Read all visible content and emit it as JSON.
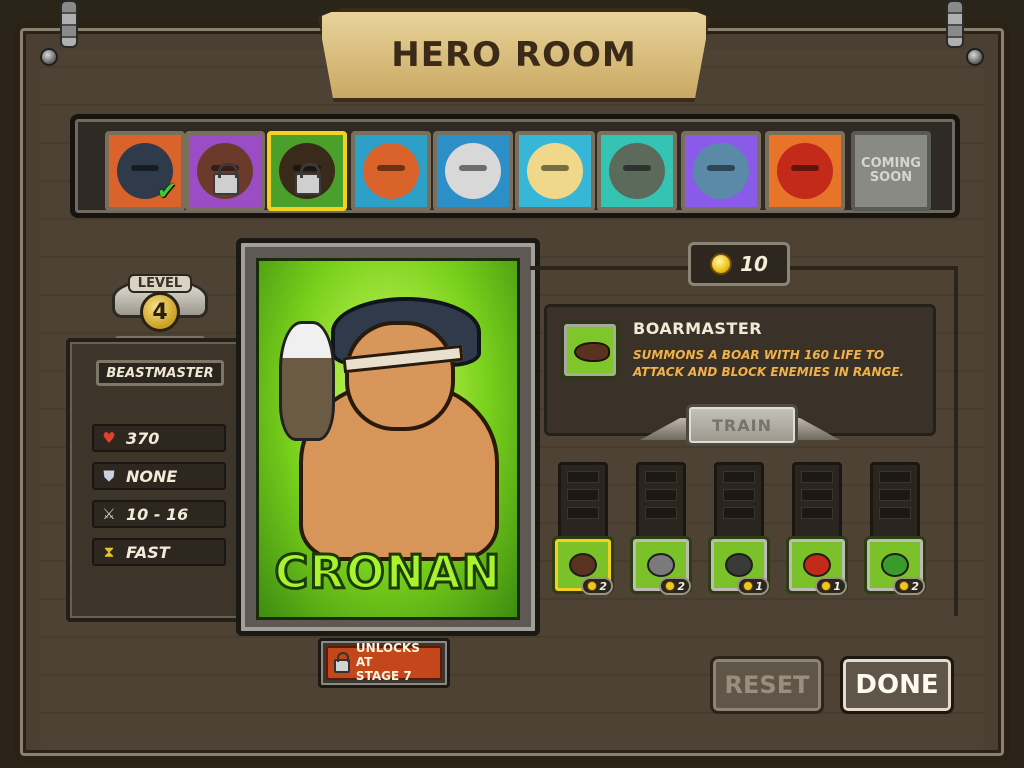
{
  "header": {
    "title": "HERO ROOM"
  },
  "heroes": [
    {
      "id": "cronan",
      "color": "#d9632a",
      "face": "#2f3a4a",
      "selected": false,
      "locked": false,
      "owned": true,
      "icon": "hero-portrait"
    },
    {
      "id": "hero-2",
      "color": "#9a4dc4",
      "face": "#6b3a2a",
      "selected": false,
      "locked": true,
      "icon": "lock-icon"
    },
    {
      "id": "hero-3",
      "color": "#4aa02a",
      "face": "#3a2a1a",
      "selected": true,
      "locked": true,
      "icon": "lock-icon"
    },
    {
      "id": "hero-4",
      "color": "#2da0c8",
      "face": "#d9632a",
      "selected": false,
      "locked": false,
      "icon": "hero-portrait"
    },
    {
      "id": "hero-5",
      "color": "#2d8fc8",
      "face": "#d8d8d8",
      "selected": false,
      "locked": false,
      "icon": "hero-portrait"
    },
    {
      "id": "hero-6",
      "color": "#36b7d8",
      "face": "#f0d88a",
      "selected": false,
      "locked": false,
      "icon": "hero-portrait"
    },
    {
      "id": "hero-7",
      "color": "#35c4b4",
      "face": "#5c6a5c",
      "selected": false,
      "locked": false,
      "icon": "hero-portrait"
    },
    {
      "id": "hero-8",
      "color": "#8a5ae8",
      "face": "#5a8aa8",
      "selected": false,
      "locked": false,
      "icon": "hero-portrait"
    },
    {
      "id": "hero-9",
      "color": "#e8742a",
      "face": "#c42a1a",
      "selected": false,
      "locked": false,
      "icon": "hero-portrait"
    }
  ],
  "coming_soon_label": "COMING SOON",
  "level": {
    "label": "LEVEL",
    "value": "4"
  },
  "hero_class": "BEASTMASTER",
  "stats": [
    {
      "icon": "heart-icon",
      "value": "370",
      "color": "#e0432b",
      "glyph": "♥"
    },
    {
      "icon": "shield-icon",
      "value": "NONE",
      "color": "#c8d2e0",
      "glyph": "⛊"
    },
    {
      "icon": "sword-icon",
      "value": "10 - 16",
      "color": "#d8d0b8",
      "glyph": "⚔"
    },
    {
      "icon": "hourglass-icon",
      "value": "FAST",
      "color": "#e8c22a",
      "glyph": "⧗"
    }
  ],
  "hero": {
    "name": "CRONAN"
  },
  "unlock": {
    "text_line1": "UNLOCKS AT",
    "text_line2": "STAGE 7"
  },
  "points": {
    "value": "10"
  },
  "skill": {
    "title": "BOARMASTER",
    "description": "SUMMONS A BOAR WITH 160 LIFE TO ATTACK AND BLOCK ENEMIES IN RANGE."
  },
  "train_label": "TRAIN",
  "skills": [
    {
      "id": "boarmaster",
      "cost": "2",
      "glyph_color": "#5a3220",
      "active": true
    },
    {
      "id": "skill-2",
      "cost": "2",
      "glyph_color": "#7a7a7a",
      "active": false
    },
    {
      "id": "skill-3",
      "cost": "1",
      "glyph_color": "#3a3a3a",
      "active": false
    },
    {
      "id": "skill-4",
      "cost": "1",
      "glyph_color": "#c42a1a",
      "active": false
    },
    {
      "id": "skill-5",
      "cost": "2",
      "glyph_color": "#3a9a2a",
      "active": false
    }
  ],
  "buttons": {
    "reset": "RESET",
    "done": "DONE"
  }
}
